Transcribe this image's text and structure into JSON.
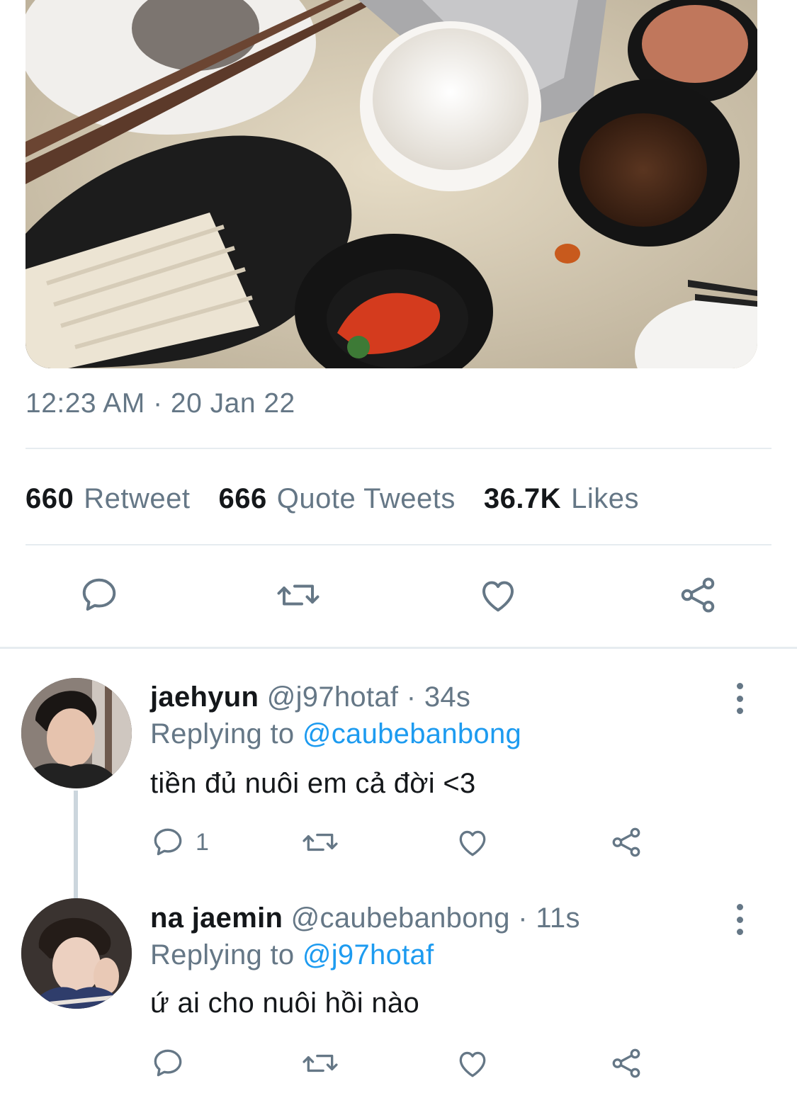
{
  "tweet": {
    "timestamp": "12:23 AM · 20 Jan 22",
    "stats": [
      {
        "count": "660",
        "label": "Retweet"
      },
      {
        "count": "666",
        "label": "Quote Tweets"
      },
      {
        "count": "36.7K",
        "label": "Likes"
      }
    ]
  },
  "replies": [
    {
      "name": "jaehyun",
      "handle": "@j97hotaf",
      "separator": "·",
      "time": "34s",
      "replying_prefix": "Replying to",
      "replying_to": "@caubebanbong",
      "text": "tiền đủ nuôi em cả đời <3",
      "reply_count": "1"
    },
    {
      "name": "na jaemin",
      "handle": "@caubebanbong",
      "separator": "·",
      "time": "11s",
      "replying_prefix": "Replying to",
      "replying_to": "@j97hotaf",
      "text": "ứ ai cho nuôi hồi nào",
      "reply_count": ""
    }
  ],
  "icons": [
    "reply-icon",
    "retweet-icon",
    "like-icon",
    "share-icon",
    "more-icon"
  ],
  "colors": {
    "accent": "#1d9bf0",
    "secondary_text": "#657786",
    "divider": "#e6ecf0"
  }
}
